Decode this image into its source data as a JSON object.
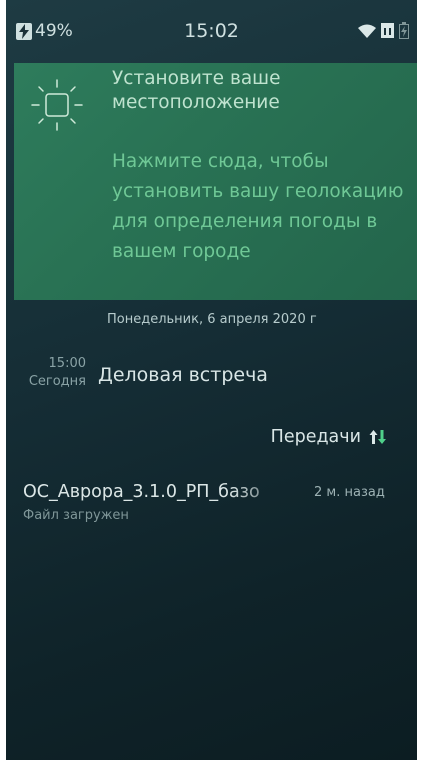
{
  "status_bar": {
    "battery_percent": "49%",
    "time": "15:02",
    "icons": [
      "charging-bolt-icon",
      "wifi-icon",
      "sim-card-icon",
      "battery-icon"
    ]
  },
  "location_card": {
    "icon": "sun-icon",
    "title": "Установите ваше местоположение",
    "description": "Нажмите сюда, чтобы установить вашу геолокацию для определения погоды в вашем городе"
  },
  "date": "Понедельник, 6 апреля 2020 г",
  "event": {
    "time": "15:00",
    "day": "Сегодня",
    "title": "Деловая встреча"
  },
  "transfers": {
    "header": "Передачи",
    "icon": "transfer-arrows-icon",
    "items": [
      {
        "file_name": "ОС_Аврора_3.1.0_РП_базо",
        "time_ago": "2 м. назад",
        "status": "Файл загружен"
      }
    ]
  },
  "colors": {
    "background": "#152d35",
    "card": "#2a7656",
    "card_title": "#bfe3cf",
    "card_text": "#6fc896",
    "accent_green": "#4fd08a"
  }
}
